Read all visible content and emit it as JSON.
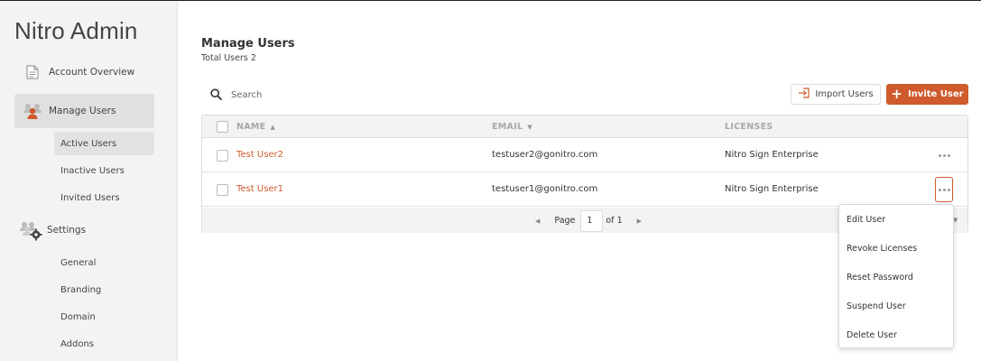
{
  "sidebar": {
    "title": "Nitro Admin",
    "account_overview": "Account Overview",
    "manage_users": "Manage Users",
    "manage_users_sub": [
      "Active Users",
      "Inactive Users",
      "Invited Users"
    ],
    "settings": "Settings",
    "settings_sub": [
      "General",
      "Branding",
      "Domain",
      "Addons"
    ]
  },
  "header": {
    "title": "Manage Users",
    "total_users": "Total Users 2"
  },
  "search": {
    "placeholder": "Search"
  },
  "toolbar": {
    "import_label": "Import Users",
    "invite_label": "Invite User"
  },
  "table": {
    "columns": [
      "NAME",
      "EMAIL",
      "LICENSES"
    ],
    "rows": [
      {
        "name": "Test User2",
        "email": "testuser2@gonitro.com",
        "license": "Nitro Sign Enterprise"
      },
      {
        "name": "Test User1",
        "email": "testuser1@gonitro.com",
        "license": "Nitro Sign Enterprise"
      }
    ]
  },
  "pagination": {
    "page_label": "Page",
    "current_page": "1",
    "of_label": "of 1"
  },
  "context_menu": [
    "Edit User",
    "Revoke Licenses",
    "Reset Password",
    "Suspend User",
    "Delete User"
  ],
  "colors": {
    "accent": "#cf5a2e",
    "sidebar_bg": "#f3f3f3"
  }
}
